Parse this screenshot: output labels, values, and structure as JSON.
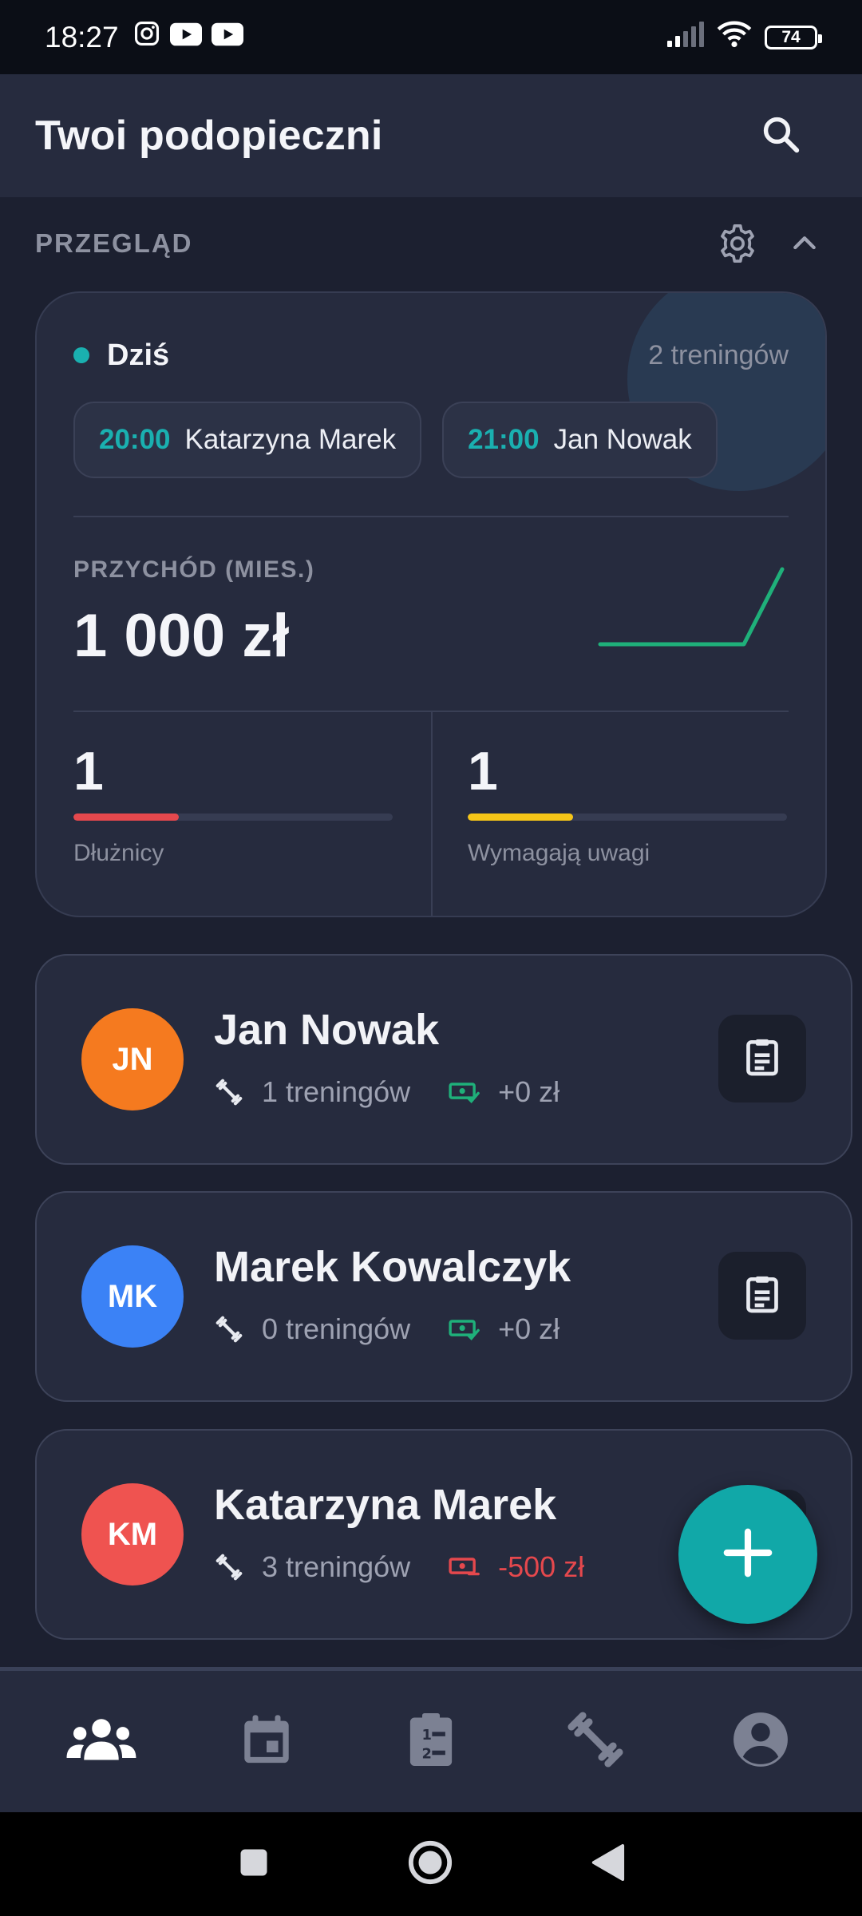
{
  "status_bar": {
    "time": "18:27",
    "battery": "74",
    "notification_icons": [
      "instagram-icon",
      "youtube-icon",
      "youtube-icon"
    ]
  },
  "header": {
    "title": "Twoi podopieczni",
    "search_icon": "search-icon"
  },
  "overview_section": {
    "title": "PRZEGLĄD",
    "settings_icon": "gear-icon",
    "collapse_icon": "chevron-up-icon"
  },
  "today": {
    "label": "Dziś",
    "count_text": "2 treningów",
    "sessions": [
      {
        "time": "20:00",
        "name": "Katarzyna Marek"
      },
      {
        "time": "21:00",
        "name": "Jan Nowak"
      }
    ]
  },
  "revenue": {
    "label": "PRZYCHÓD (MIES.)",
    "value": "1 000 zł",
    "trend_color": "#1fb07a"
  },
  "stats": [
    {
      "value": "1",
      "label": "Dłużnicy",
      "progress": 0.33,
      "color": "#e5484d"
    },
    {
      "value": "1",
      "label": "Wymagają uwagi",
      "progress": 0.33,
      "color": "#f5c518"
    }
  ],
  "clients": [
    {
      "initials": "JN",
      "name": "Jan Nowak",
      "trainings": "1 treningów",
      "balance": "+0 zł",
      "balance_status": "ok",
      "avatar_color": "#f57a1f"
    },
    {
      "initials": "MK",
      "name": "Marek Kowalczyk",
      "trainings": "0 treningów",
      "balance": "+0 zł",
      "balance_status": "ok",
      "avatar_color": "#3b82f6"
    },
    {
      "initials": "KM",
      "name": "Katarzyna Marek",
      "trainings": "3 treningów",
      "balance": "-500 zł",
      "balance_status": "debt",
      "avatar_color": "#ef5350"
    }
  ],
  "fab_icon": "plus-icon",
  "bottom_nav": [
    {
      "icon": "people-icon",
      "active": true
    },
    {
      "icon": "calendar-icon",
      "active": false
    },
    {
      "icon": "clipboard-list-icon",
      "active": false
    },
    {
      "icon": "dumbbell-icon",
      "active": false
    },
    {
      "icon": "account-icon",
      "active": false
    }
  ],
  "colors": {
    "accent": "#11a8a8",
    "ok": "#1fb07a",
    "debt": "#e5484d"
  }
}
